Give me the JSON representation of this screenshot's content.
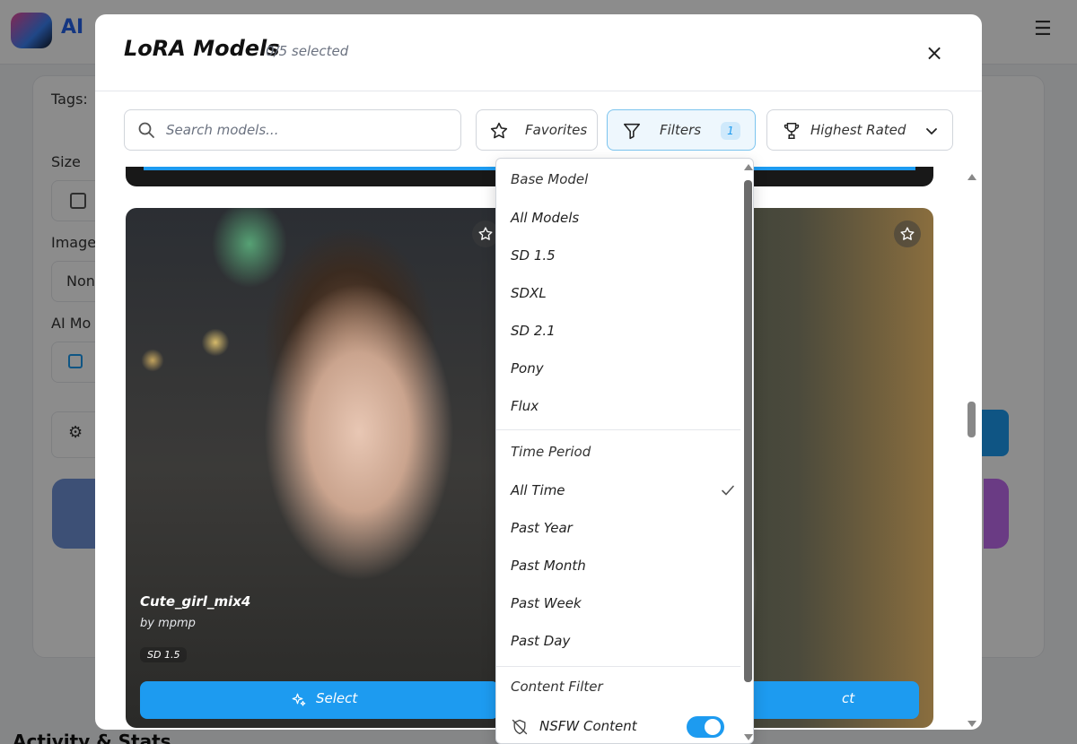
{
  "background": {
    "app_title": "AI",
    "labels": [
      "Tags:",
      "Size",
      "Image",
      "AI Mo",
      "Non"
    ],
    "section_title": "Activity & Stats"
  },
  "modal": {
    "title": "LoRA Models",
    "subtitle": "0/5 selected",
    "close": "×"
  },
  "toolbar": {
    "search_placeholder": "Search models...",
    "favorites_label": "Favorites",
    "filters_label": "Filters",
    "filters_count": "1",
    "sort_label": "Highest Rated"
  },
  "cards": [
    {
      "name": "Cute_girl_mix4",
      "author": "by mpmp",
      "tag": "SD 1.5",
      "select_label": "Select"
    },
    {
      "select_label": "ct"
    }
  ],
  "dropdown": {
    "base_model_title": "Base Model",
    "base_models": [
      "All Models",
      "SD 1.5",
      "SDXL",
      "SD 2.1",
      "Pony",
      "Flux"
    ],
    "time_period_title": "Time Period",
    "time_periods": [
      "All Time",
      "Past Year",
      "Past Month",
      "Past Week",
      "Past Day"
    ],
    "selected_time_period": "All Time",
    "content_filter_title": "Content Filter",
    "nsfw_label": "NSFW Content",
    "nsfw_enabled": true
  },
  "colors": {
    "accent": "#1d9bf0",
    "filter_bg": "#eef7fd"
  }
}
